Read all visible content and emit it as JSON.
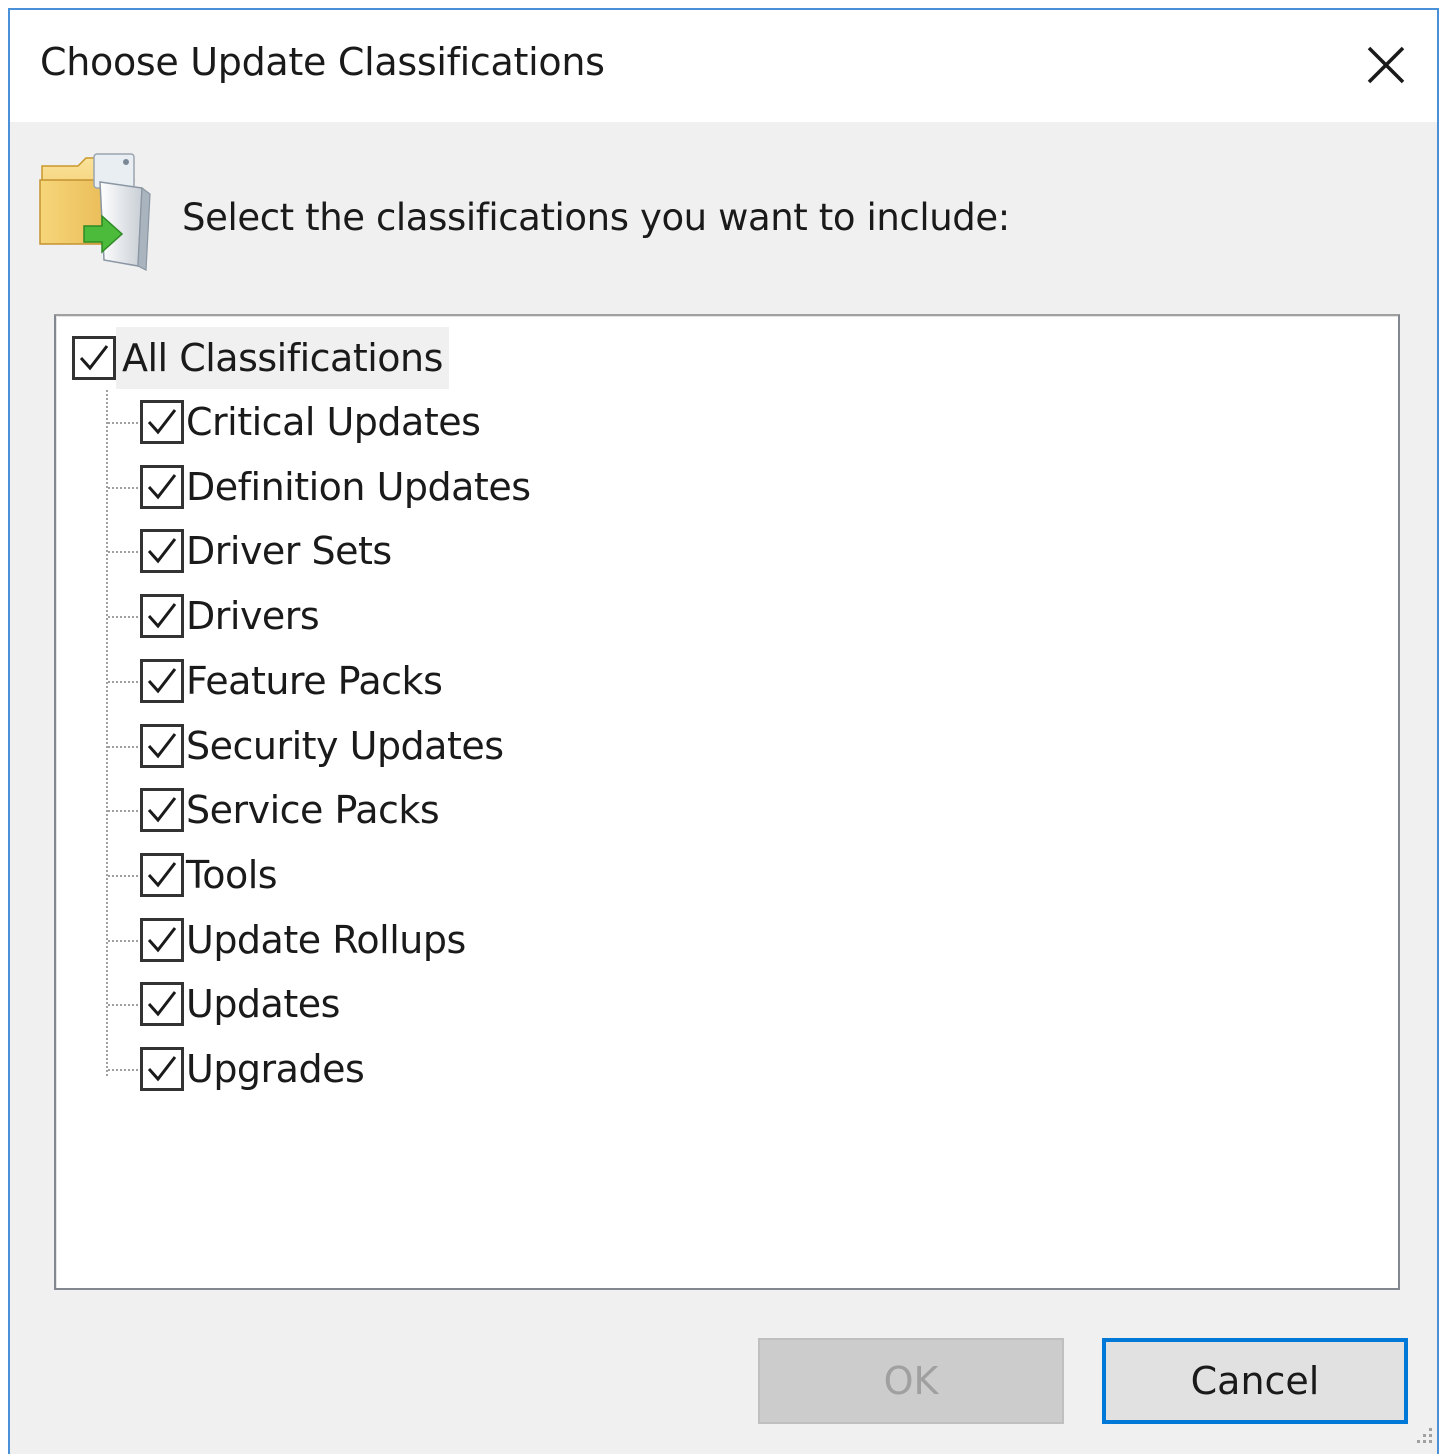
{
  "window": {
    "title": "Choose Update Classifications",
    "accent_color": "#0078d7"
  },
  "header": {
    "icon": "folder-with-update-icon",
    "instruction": "Select the classifications you want to include:"
  },
  "tree": {
    "root": {
      "label": "All Classifications",
      "checked": true
    },
    "items": [
      {
        "label": "Critical Updates",
        "checked": true
      },
      {
        "label": "Definition Updates",
        "checked": true
      },
      {
        "label": "Driver Sets",
        "checked": true
      },
      {
        "label": "Drivers",
        "checked": true
      },
      {
        "label": "Feature Packs",
        "checked": true
      },
      {
        "label": "Security Updates",
        "checked": true
      },
      {
        "label": "Service Packs",
        "checked": true
      },
      {
        "label": "Tools",
        "checked": true
      },
      {
        "label": "Update Rollups",
        "checked": true
      },
      {
        "label": "Updates",
        "checked": true
      },
      {
        "label": "Upgrades",
        "checked": true
      }
    ]
  },
  "buttons": {
    "ok_label": "OK",
    "ok_enabled": false,
    "cancel_label": "Cancel"
  }
}
